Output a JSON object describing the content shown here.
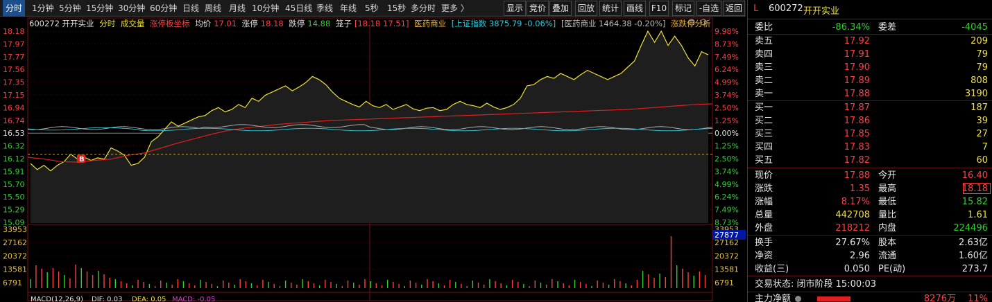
{
  "toolbar": {
    "periods": [
      "分时",
      "1分钟",
      "5分钟",
      "15分钟",
      "30分钟",
      "60分钟",
      "日线",
      "周线",
      "月线",
      "10分钟",
      "45日线",
      "季线",
      "年线",
      "5秒",
      "15秒",
      "多分时",
      "更多 〉"
    ],
    "actions": [
      "显示",
      "竞价",
      "叠加",
      "回放",
      "统计",
      "画线",
      "F10",
      "标记",
      "-自选",
      "返回"
    ]
  },
  "info": {
    "code_name": "600272 开开实业",
    "mode": "分时",
    "vol": "成交量",
    "limit_axis": "涨停板坐标",
    "avg_label": "均价",
    "avg_value": "17.01",
    "up_limit_label": "涨停",
    "up_limit_value": "18.18",
    "down_limit_label": "跌停",
    "down_limit_value": "14.88",
    "cage_label": "笼子",
    "cage_value": "[18.18 17.51]",
    "sector": "医药商业",
    "index_text": "[上证指数 3875.79 -0.06%]",
    "sector_index_text": "[医药商业 1464.38 -0.20%]",
    "analysis": "涨跌停分析"
  },
  "axes": {
    "price_ticks": [
      "18.18",
      "17.97",
      "17.77",
      "17.56",
      "17.35",
      "17.15",
      "16.94",
      "16.74",
      "16.53",
      "16.32",
      "16.12",
      "15.91",
      "15.70",
      "15.50",
      "15.29",
      "15.09"
    ],
    "pct_ticks": [
      "9.98%",
      "8.73%",
      "7.49%",
      "6.24%",
      "4.99%",
      "3.74%",
      "2.50%",
      "1.25%",
      "0.00%",
      "1.25%",
      "2.50%",
      "3.74%",
      "4.99%",
      "6.24%",
      "7.49%",
      "8.73%"
    ],
    "vol_ticks_left": [
      "33953",
      "27162",
      "20372",
      "13581",
      "6791"
    ],
    "vol_ticks_right": [
      "33953",
      "27162",
      "20372",
      "13581",
      "6791"
    ],
    "vol_cursor_value": "27877",
    "b_marker": "B"
  },
  "macd": {
    "label": "MACD(12,26,9)",
    "dif": "DIF: 0.03",
    "dea": "DEA: 0.05",
    "macd": "MACD: -0.05"
  },
  "chart_data": {
    "type": "line",
    "title": "600272 开开实业 分时",
    "prev_close": 16.53,
    "ylim": [
      15.09,
      18.18
    ],
    "series": [
      {
        "name": "分时",
        "values": [
          16.05,
          15.95,
          16.02,
          15.93,
          16.02,
          16.08,
          16.2,
          16.12,
          16.15,
          16.1,
          16.14,
          16.12,
          16.3,
          16.25,
          16.18,
          16.02,
          16.05,
          16.15,
          16.4,
          16.48,
          16.6,
          16.72,
          16.65,
          16.7,
          16.75,
          16.8,
          16.82,
          16.9,
          16.95,
          16.88,
          16.92,
          17.0,
          16.95,
          17.1,
          17.05,
          17.15,
          17.2,
          17.25,
          17.3,
          17.22,
          17.28,
          17.35,
          17.45,
          17.4,
          17.32,
          17.2,
          17.1,
          17.05,
          17.0,
          16.96,
          17.05,
          16.98,
          16.95,
          17.0,
          16.92,
          16.96,
          17.0,
          16.93,
          16.9,
          16.94,
          16.95,
          16.9,
          16.92,
          17.0,
          17.05,
          17.0,
          16.98,
          16.95,
          17.02,
          16.96,
          16.92,
          16.95,
          17.0,
          17.1,
          17.3,
          17.32,
          17.4,
          17.45,
          17.42,
          17.5,
          17.45,
          17.4,
          17.48,
          17.55,
          17.5,
          17.45,
          17.4,
          17.45,
          17.5,
          17.6,
          17.7,
          17.95,
          18.18,
          18.0,
          18.18,
          17.95,
          18.1,
          17.95,
          17.75,
          17.62,
          17.85,
          17.8
        ]
      },
      {
        "name": "均价",
        "values": [
          16.15,
          16.12,
          16.08,
          16.07,
          16.1,
          16.12,
          16.18,
          16.22,
          16.3,
          16.38,
          16.45,
          16.52,
          16.58,
          16.62,
          16.65,
          16.68,
          16.7,
          16.72,
          16.74,
          16.75,
          16.76,
          16.77,
          16.78,
          16.79,
          16.8,
          16.81,
          16.82,
          16.83,
          16.84,
          16.85,
          16.86,
          16.87,
          16.88,
          16.89,
          16.9,
          16.91,
          16.92,
          16.94,
          16.96,
          16.98,
          17.0,
          17.01
        ]
      }
    ]
  },
  "panel": {
    "flag": "L",
    "code": "600272",
    "name": "开开实业",
    "wei_bi_label": "委比",
    "wei_bi_value": "-86.34%",
    "wei_cha_label": "委差",
    "wei_cha_value": "-4045",
    "asks": [
      {
        "label": "卖五",
        "price": "17.92",
        "vol": "209"
      },
      {
        "label": "卖四",
        "price": "17.91",
        "vol": "79"
      },
      {
        "label": "卖三",
        "price": "17.90",
        "vol": "79"
      },
      {
        "label": "卖二",
        "price": "17.89",
        "vol": "808"
      },
      {
        "label": "卖一",
        "price": "17.88",
        "vol": "3190"
      }
    ],
    "bids": [
      {
        "label": "买一",
        "price": "17.87",
        "vol": "187"
      },
      {
        "label": "买二",
        "price": "17.86",
        "vol": "39"
      },
      {
        "label": "买三",
        "price": "17.85",
        "vol": "27"
      },
      {
        "label": "买四",
        "price": "17.83",
        "vol": "7"
      },
      {
        "label": "买五",
        "price": "17.82",
        "vol": "60"
      }
    ],
    "quote": [
      {
        "l1": "现价",
        "v1": "17.88",
        "l2": "今开",
        "v2": "16.40"
      },
      {
        "l1": "涨跌",
        "v1": "1.35",
        "l2": "最高",
        "v2": "18.18"
      },
      {
        "l1": "涨幅",
        "v1": "8.17%",
        "l2": "最低",
        "v2": "15.82"
      },
      {
        "l1": "总量",
        "v1": "442708",
        "l2": "量比",
        "v2": "1.61"
      },
      {
        "l1": "外盘",
        "v1": "218212",
        "l2": "内盘",
        "v2": "224496"
      }
    ],
    "fund": [
      {
        "l1": "换手",
        "v1": "27.67%",
        "l2": "股本",
        "v2": "2.63亿"
      },
      {
        "l1": "净资",
        "v1": "2.96",
        "l2": "流通",
        "v2": "1.60亿"
      },
      {
        "l1": "收益(三)",
        "v1": "0.050",
        "l2": "PE(动)",
        "v2": "273.7"
      }
    ],
    "status_label": "交易状态:",
    "status_value": "闭市阶段 15:00:03",
    "main_flow_label": "主力净额",
    "main_flow_value": "8276万",
    "main_flow_pct": "11%"
  }
}
